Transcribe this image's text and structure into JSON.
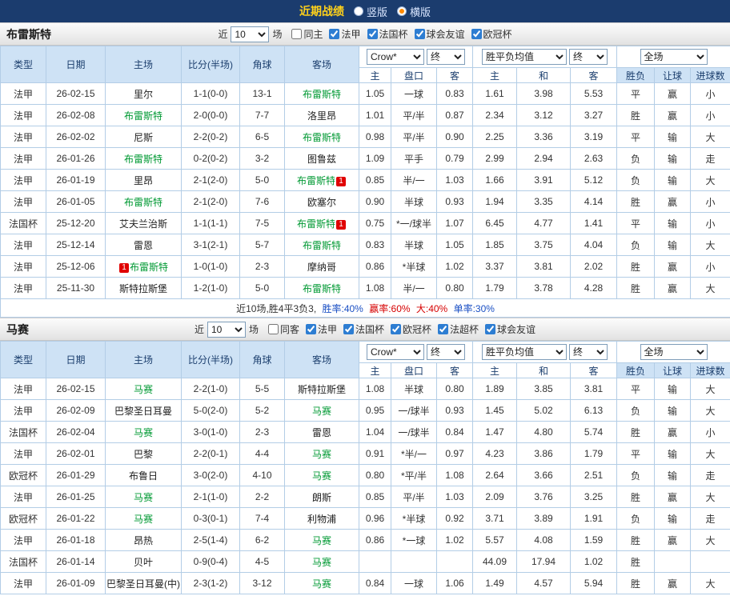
{
  "topbar": {
    "title": "近期战绩",
    "radios": [
      {
        "label": "竖版",
        "selected": false
      },
      {
        "label": "横版",
        "selected": true
      }
    ]
  },
  "colors": {
    "navy": "#1b3c6e",
    "title_yellow": "#ffd11a",
    "ligue1_badge": "#7d2e29",
    "french_cup_badge": "#2e6cc0",
    "ucl_badge": "#e0761f",
    "win_red": "#d60000",
    "lose_green": "#009933",
    "draw_blue": "#1a4fc4",
    "subject_team_green": "#009933"
  },
  "sections": [
    {
      "team": "布雷斯特",
      "filter": {
        "near_label": "近",
        "count": "10",
        "games_label": "场",
        "checkboxes": [
          {
            "label": "同主",
            "checked": false
          },
          {
            "label": "法甲",
            "checked": true
          },
          {
            "label": "法国杯",
            "checked": true
          },
          {
            "label": "球会友谊",
            "checked": true
          },
          {
            "label": "欧冠杯",
            "checked": true
          }
        ]
      },
      "header": {
        "type": "类型",
        "date": "日期",
        "home": "主场",
        "score": "比分(半场)",
        "corner": "角球",
        "away": "客场",
        "odds_company": "Crow*",
        "odds_state": "终",
        "avg_label": "胜平负均值",
        "avg_state": "终",
        "scope_label": "全场",
        "sub": [
          "主",
          "盘口",
          "客",
          "主",
          "和",
          "客",
          "胜负",
          "让球",
          "进球数"
        ]
      },
      "rows": [
        {
          "type": "法甲",
          "date": "26-02-15",
          "home": {
            "name": "里尔"
          },
          "score": "1-1(0-0)",
          "corner": "13-1",
          "away": {
            "name": "布雷斯特",
            "subject": true
          },
          "odds_home": "1.05",
          "handicap": "一球",
          "odds_away": "0.83",
          "avg_home": "1.61",
          "avg_draw": "3.98",
          "avg_away": "5.53",
          "result": "平",
          "handicap_result": "赢",
          "goals_result": "小"
        },
        {
          "type": "法甲",
          "date": "26-02-08",
          "home": {
            "name": "布雷斯特",
            "subject": true
          },
          "score": "2-0(0-0)",
          "corner": "7-7",
          "away": {
            "name": "洛里昂"
          },
          "odds_home": "1.01",
          "handicap": "平/半",
          "odds_away": "0.87",
          "avg_home": "2.34",
          "avg_draw": "3.12",
          "avg_away": "3.27",
          "result": "胜",
          "handicap_result": "赢",
          "goals_result": "小"
        },
        {
          "type": "法甲",
          "date": "26-02-02",
          "home": {
            "name": "尼斯"
          },
          "score": "2-2(0-2)",
          "corner": "6-5",
          "away": {
            "name": "布雷斯特",
            "subject": true
          },
          "odds_home": "0.98",
          "handicap": "平/半",
          "odds_away": "0.90",
          "avg_home": "2.25",
          "avg_draw": "3.36",
          "avg_away": "3.19",
          "result": "平",
          "handicap_result": "输",
          "goals_result": "大"
        },
        {
          "type": "法甲",
          "date": "26-01-26",
          "home": {
            "name": "布雷斯特",
            "subject": true
          },
          "score": "0-2(0-2)",
          "corner": "3-2",
          "away": {
            "name": "图鲁兹"
          },
          "odds_home": "1.09",
          "handicap": "平手",
          "odds_away": "0.79",
          "avg_home": "2.99",
          "avg_draw": "2.94",
          "avg_away": "2.63",
          "result": "负",
          "handicap_result": "输",
          "goals_result": "走"
        },
        {
          "type": "法甲",
          "date": "26-01-19",
          "home": {
            "name": "里昂"
          },
          "score": "2-1(2-0)",
          "corner": "5-0",
          "away": {
            "name": "布雷斯特",
            "subject": true,
            "badge": "1",
            "badge_pos": "after"
          },
          "odds_home": "0.85",
          "handicap": "半/一",
          "odds_away": "1.03",
          "avg_home": "1.66",
          "avg_draw": "3.91",
          "avg_away": "5.12",
          "result": "负",
          "handicap_result": "输",
          "goals_result": "大"
        },
        {
          "type": "法甲",
          "date": "26-01-05",
          "home": {
            "name": "布雷斯特",
            "subject": true
          },
          "score": "2-1(2-0)",
          "corner": "7-6",
          "away": {
            "name": "欧塞尔"
          },
          "odds_home": "0.90",
          "handicap": "半球",
          "odds_away": "0.93",
          "avg_home": "1.94",
          "avg_draw": "3.35",
          "avg_away": "4.14",
          "result": "胜",
          "handicap_result": "赢",
          "goals_result": "小"
        },
        {
          "type": "法国杯",
          "date": "25-12-20",
          "home": {
            "name": "艾夫兰治斯"
          },
          "score": "1-1(1-1)",
          "corner": "7-5",
          "away": {
            "name": "布雷斯特",
            "subject": true,
            "badge": "1",
            "badge_pos": "after"
          },
          "odds_home": "0.75",
          "handicap": "*一/球半",
          "odds_away": "1.07",
          "avg_home": "6.45",
          "avg_draw": "4.77",
          "avg_away": "1.41",
          "result": "平",
          "handicap_result": "输",
          "goals_result": "小"
        },
        {
          "type": "法甲",
          "date": "25-12-14",
          "home": {
            "name": "雷恩"
          },
          "score": "3-1(2-1)",
          "corner": "5-7",
          "away": {
            "name": "布雷斯特",
            "subject": true
          },
          "odds_home": "0.83",
          "handicap": "半球",
          "odds_away": "1.05",
          "avg_home": "1.85",
          "avg_draw": "3.75",
          "avg_away": "4.04",
          "result": "负",
          "handicap_result": "输",
          "goals_result": "大"
        },
        {
          "type": "法甲",
          "date": "25-12-06",
          "home": {
            "name": "布雷斯特",
            "subject": true,
            "badge": "1",
            "badge_pos": "before"
          },
          "score": "1-0(1-0)",
          "corner": "2-3",
          "away": {
            "name": "摩纳哥"
          },
          "odds_home": "0.86",
          "handicap": "*半球",
          "odds_away": "1.02",
          "avg_home": "3.37",
          "avg_draw": "3.81",
          "avg_away": "2.02",
          "result": "胜",
          "handicap_result": "赢",
          "goals_result": "小"
        },
        {
          "type": "法甲",
          "date": "25-11-30",
          "home": {
            "name": "斯特拉斯堡"
          },
          "score": "1-2(1-0)",
          "corner": "5-0",
          "away": {
            "name": "布雷斯特",
            "subject": true
          },
          "odds_home": "1.08",
          "handicap": "半/一",
          "odds_away": "0.80",
          "avg_home": "1.79",
          "avg_draw": "3.78",
          "avg_away": "4.28",
          "result": "胜",
          "handicap_result": "赢",
          "goals_result": "大"
        }
      ],
      "summary": [
        {
          "text": "近10场,胜4平3负3, ",
          "color": "#333333"
        },
        {
          "text": "胜率:40% ",
          "color": "#1a4fc4"
        },
        {
          "text": "赢率:60% ",
          "color": "#d60000"
        },
        {
          "text": "大:40% ",
          "color": "#d60000"
        },
        {
          "text": "单率:30%",
          "color": "#1a4fc4"
        }
      ]
    },
    {
      "team": "马赛",
      "filter": {
        "near_label": "近",
        "count": "10",
        "games_label": "场",
        "checkboxes": [
          {
            "label": "同客",
            "checked": false
          },
          {
            "label": "法甲",
            "checked": true
          },
          {
            "label": "法国杯",
            "checked": true
          },
          {
            "label": "欧冠杯",
            "checked": true
          },
          {
            "label": "法超杯",
            "checked": true
          },
          {
            "label": "球会友谊",
            "checked": true
          }
        ]
      },
      "header": {
        "type": "类型",
        "date": "日期",
        "home": "主场",
        "score": "比分(半场)",
        "corner": "角球",
        "away": "客场",
        "odds_company": "Crow*",
        "odds_state": "终",
        "avg_label": "胜平负均值",
        "avg_state": "终",
        "scope_label": "全场",
        "sub": [
          "主",
          "盘口",
          "客",
          "主",
          "和",
          "客",
          "胜负",
          "让球",
          "进球数"
        ]
      },
      "rows": [
        {
          "type": "法甲",
          "date": "26-02-15",
          "home": {
            "name": "马赛",
            "subject": true
          },
          "score": "2-2(1-0)",
          "corner": "5-5",
          "away": {
            "name": "斯特拉斯堡"
          },
          "odds_home": "1.08",
          "handicap": "半球",
          "odds_away": "0.80",
          "avg_home": "1.89",
          "avg_draw": "3.85",
          "avg_away": "3.81",
          "result": "平",
          "handicap_result": "输",
          "goals_result": "大"
        },
        {
          "type": "法甲",
          "date": "26-02-09",
          "home": {
            "name": "巴黎圣日耳曼"
          },
          "score": "5-0(2-0)",
          "corner": "5-2",
          "away": {
            "name": "马赛",
            "subject": true
          },
          "odds_home": "0.95",
          "handicap": "一/球半",
          "odds_away": "0.93",
          "avg_home": "1.45",
          "avg_draw": "5.02",
          "avg_away": "6.13",
          "result": "负",
          "handicap_result": "输",
          "goals_result": "大"
        },
        {
          "type": "法国杯",
          "date": "26-02-04",
          "home": {
            "name": "马赛",
            "subject": true
          },
          "score": "3-0(1-0)",
          "corner": "2-3",
          "away": {
            "name": "雷恩"
          },
          "odds_home": "1.04",
          "handicap": "一/球半",
          "odds_away": "0.84",
          "avg_home": "1.47",
          "avg_draw": "4.80",
          "avg_away": "5.74",
          "result": "胜",
          "handicap_result": "赢",
          "goals_result": "小"
        },
        {
          "type": "法甲",
          "date": "26-02-01",
          "home": {
            "name": "巴黎"
          },
          "score": "2-2(0-1)",
          "corner": "4-4",
          "away": {
            "name": "马赛",
            "subject": true
          },
          "odds_home": "0.91",
          "handicap": "*半/一",
          "odds_away": "0.97",
          "avg_home": "4.23",
          "avg_draw": "3.86",
          "avg_away": "1.79",
          "result": "平",
          "handicap_result": "输",
          "goals_result": "大"
        },
        {
          "type": "欧冠杯",
          "date": "26-01-29",
          "home": {
            "name": "布鲁日"
          },
          "score": "3-0(2-0)",
          "corner": "4-10",
          "away": {
            "name": "马赛",
            "subject": true
          },
          "odds_home": "0.80",
          "handicap": "*平/半",
          "odds_away": "1.08",
          "avg_home": "2.64",
          "avg_draw": "3.66",
          "avg_away": "2.51",
          "result": "负",
          "handicap_result": "输",
          "goals_result": "走"
        },
        {
          "type": "法甲",
          "date": "26-01-25",
          "home": {
            "name": "马赛",
            "subject": true
          },
          "score": "2-1(1-0)",
          "corner": "2-2",
          "away": {
            "name": "朗斯"
          },
          "odds_home": "0.85",
          "handicap": "平/半",
          "odds_away": "1.03",
          "avg_home": "2.09",
          "avg_draw": "3.76",
          "avg_away": "3.25",
          "result": "胜",
          "handicap_result": "赢",
          "goals_result": "大"
        },
        {
          "type": "欧冠杯",
          "date": "26-01-22",
          "home": {
            "name": "马赛",
            "subject": true
          },
          "score": "0-3(0-1)",
          "corner": "7-4",
          "away": {
            "name": "利物浦"
          },
          "odds_home": "0.96",
          "handicap": "*半球",
          "odds_away": "0.92",
          "avg_home": "3.71",
          "avg_draw": "3.89",
          "avg_away": "1.91",
          "result": "负",
          "handicap_result": "输",
          "goals_result": "走"
        },
        {
          "type": "法甲",
          "date": "26-01-18",
          "home": {
            "name": "昂热"
          },
          "score": "2-5(1-4)",
          "corner": "6-2",
          "away": {
            "name": "马赛",
            "subject": true
          },
          "odds_home": "0.86",
          "handicap": "*一球",
          "odds_away": "1.02",
          "avg_home": "5.57",
          "avg_draw": "4.08",
          "avg_away": "1.59",
          "result": "胜",
          "handicap_result": "赢",
          "goals_result": "大"
        },
        {
          "type": "法国杯",
          "date": "26-01-14",
          "home": {
            "name": "贝叶"
          },
          "score": "0-9(0-4)",
          "corner": "4-5",
          "away": {
            "name": "马赛",
            "subject": true
          },
          "odds_home": "",
          "handicap": "",
          "odds_away": "",
          "avg_home": "44.09",
          "avg_draw": "17.94",
          "avg_away": "1.02",
          "result": "胜",
          "handicap_result": "",
          "goals_result": ""
        },
        {
          "type": "法甲",
          "date": "26-01-09",
          "home": {
            "name": "巴黎圣日耳曼(中)"
          },
          "score": "2-3(1-2)",
          "corner": "3-12",
          "away": {
            "name": "马赛",
            "subject": true
          },
          "odds_home": "0.84",
          "handicap": "一球",
          "odds_away": "1.06",
          "avg_home": "1.49",
          "avg_draw": "4.57",
          "avg_away": "5.94",
          "result": "胜",
          "handicap_result": "赢",
          "goals_result": "大"
        }
      ],
      "summary": []
    }
  ]
}
